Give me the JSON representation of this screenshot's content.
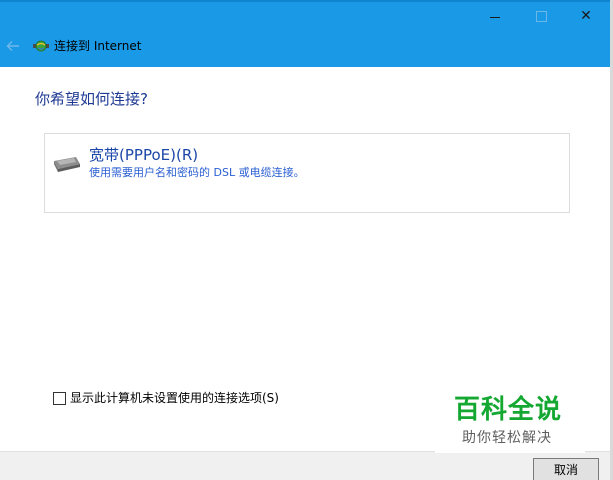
{
  "window": {
    "title": "连接到 Internet",
    "accent_color": "#1a9ae6",
    "controls": {
      "minimize_icon": "minimize-icon",
      "maximize_icon": "maximize-icon",
      "close_icon": "close-icon",
      "close_glyph": "✕"
    },
    "back_icon": "back-arrow-icon",
    "app_icon": "network-globe-icon"
  },
  "main": {
    "question": "你希望如何连接?",
    "option": {
      "title": "宽带(PPPoE)(R)",
      "description": "使用需要用户名和密码的 DSL 或电缆连接。",
      "icon": "broadband-modem-icon"
    },
    "show_unconfigured_option": {
      "label": "显示此计算机未设置使用的连接选项(S)",
      "checked": false
    }
  },
  "footer": {
    "cancel_label": "取消"
  },
  "watermark": {
    "title": "百科全说",
    "subtitle": "助你轻松解决",
    "color": "#14a832"
  }
}
